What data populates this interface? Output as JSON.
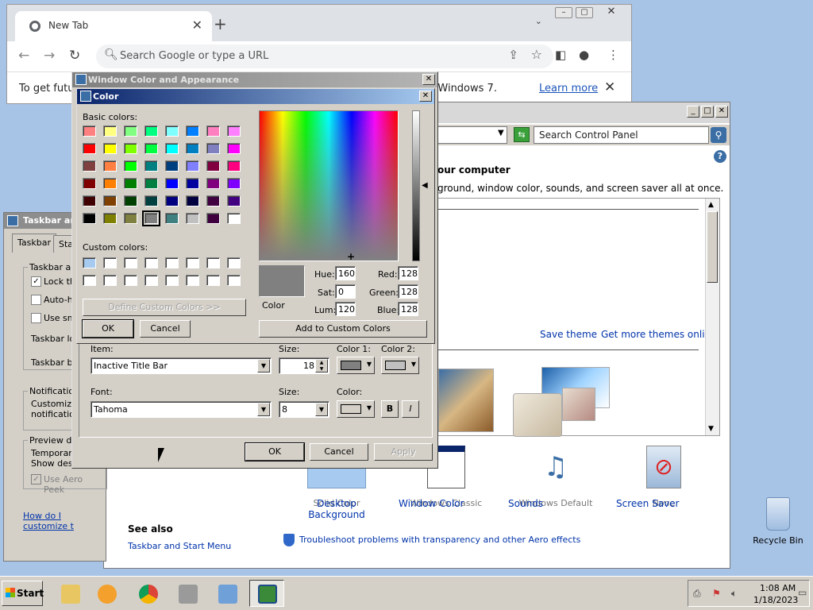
{
  "chrome": {
    "tab_title": "New Tab",
    "omnibox_placeholder": "Search Google or type a URL",
    "infobar_text_start": "To get futu",
    "infobar_text_end": "g Windows 7.",
    "infobar_link": "Learn more"
  },
  "control_panel": {
    "search_placeholder": "Search Control Panel",
    "heading": "our computer",
    "subheading": "ground, window color, sounds, and screen saver all at once.",
    "save_theme": "Save theme",
    "more_themes": "Get more themes online",
    "tiles": [
      {
        "label": "Desktop Background",
        "sub": "Solid Color"
      },
      {
        "label": "Window Color",
        "sub": "Windows Classic"
      },
      {
        "label": "Sounds",
        "sub": "Windows Default"
      },
      {
        "label": "Screen Saver",
        "sub": "None"
      }
    ],
    "see_also": "See also",
    "taskbar_link": "Taskbar and Start Menu",
    "troubleshoot_link": "Troubleshoot problems with transparency and other Aero effects"
  },
  "taskbar_props": {
    "title": "Taskbar an",
    "tabs": [
      "Taskbar",
      "Sta"
    ],
    "group1_label": "Taskbar ap",
    "opt_lock": "Lock th",
    "opt_autohide": "Auto-h",
    "opt_small": "Use sm",
    "taskbar_location": "Taskbar lo",
    "taskbar_buttons": "Taskbar bu",
    "notif_label": "Notification",
    "notif_text1": "Customize",
    "notif_text2": "notification",
    "preview_label": "Preview de",
    "preview_text1": "Temporari",
    "preview_text2": "Show desk",
    "aero_peek": "Use Aero Peek",
    "how_link": "How do I customize t"
  },
  "window_color": {
    "title": "Window Color and Appearance",
    "item_label": "Item:",
    "item_value": "Inactive Title Bar",
    "size_label": "Size:",
    "size_value": "18",
    "color1_label": "Color 1:",
    "color2_label": "Color 2:",
    "color1": "#808080",
    "color2": "#c0c0c0",
    "font_label": "Font:",
    "font_value": "Tahoma",
    "font_size_label": "Size:",
    "font_size_value": "8",
    "font_color_label": "Color:",
    "font_color": "#d4d0c8",
    "bold": "B",
    "italic": "I",
    "ok": "OK",
    "cancel": "Cancel",
    "apply": "Apply"
  },
  "color_dialog": {
    "title": "Color",
    "basic_colors_label": "Basic colors:",
    "basic_colors": [
      "#ff8080",
      "#ffff80",
      "#80ff80",
      "#00ff80",
      "#80ffff",
      "#0080ff",
      "#ff80c0",
      "#ff80ff",
      "#ff0000",
      "#ffff00",
      "#80ff00",
      "#00ff40",
      "#00ffff",
      "#0080c0",
      "#8080c0",
      "#ff00ff",
      "#804040",
      "#ff8040",
      "#00ff00",
      "#008080",
      "#004080",
      "#8080ff",
      "#800040",
      "#ff0080",
      "#800000",
      "#ff8000",
      "#008000",
      "#008040",
      "#0000ff",
      "#0000a0",
      "#800080",
      "#8000ff",
      "#400000",
      "#804000",
      "#004000",
      "#004040",
      "#000080",
      "#000040",
      "#400040",
      "#400080",
      "#000000",
      "#808000",
      "#808040",
      "#808080",
      "#408080",
      "#c0c0c0",
      "#400040",
      "#ffffff"
    ],
    "selected_index": 43,
    "custom_colors_label": "Custom colors:",
    "custom_colors": [
      "#a6caf0",
      "#ffffff",
      "#ffffff",
      "#ffffff",
      "#ffffff",
      "#ffffff",
      "#ffffff",
      "#ffffff",
      "#ffffff",
      "#ffffff",
      "#ffffff",
      "#ffffff",
      "#ffffff",
      "#ffffff",
      "#ffffff",
      "#ffffff"
    ],
    "define_custom": "Define Custom Colors >>",
    "ok": "OK",
    "cancel": "Cancel",
    "color_label": "Color",
    "hue_label": "Hue:",
    "hue": "160",
    "sat_label": "Sat:",
    "sat": "0",
    "lum_label": "Lum:",
    "lum": "120",
    "red_label": "Red:",
    "red": "128",
    "green_label": "Green:",
    "green": "128",
    "blue_label": "Blue:",
    "blue": "128",
    "add_custom": "Add to Custom Colors"
  },
  "desktop": {
    "recycle_bin": "Recycle Bin"
  },
  "taskbar": {
    "start": "Start",
    "time": "1:08 AM",
    "date": "1/18/2023"
  }
}
